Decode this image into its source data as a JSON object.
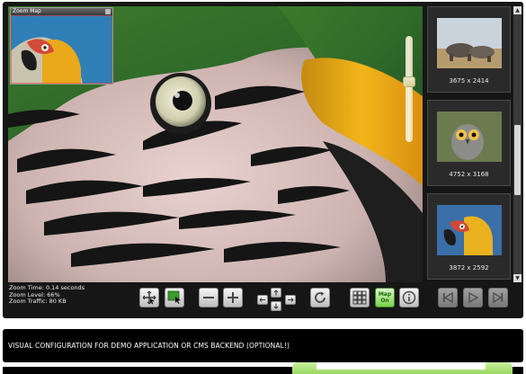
{
  "zoom_map": {
    "title": "Zoom Map"
  },
  "status": {
    "zoom_time": "Zoom Time: 0.14 seconds",
    "zoom_level": "Zoom Level: 66%",
    "zoom_traffic": "Zoom Traffic: 80 KB"
  },
  "zoom_slider": {
    "level": 0.42
  },
  "gallery": {
    "items": [
      {
        "icon": "rhino-thumbnail",
        "size": "3675 x 2414"
      },
      {
        "icon": "owl-thumbnail",
        "size": "4752 x 3168"
      },
      {
        "icon": "parrot-thumbnail",
        "size": "3872 x 2592"
      }
    ]
  },
  "toolbar": {
    "map_label_top": "Map",
    "map_label_bottom": "On",
    "icons": [
      "pan-icon",
      "select-zoom-icon",
      "zoom-out-icon",
      "zoom-in-icon",
      "pan-left-icon",
      "pan-up-icon",
      "pan-down-icon",
      "pan-right-icon",
      "reset-icon",
      "grid-icon",
      "map-toggle",
      "info-icon",
      "first-icon",
      "play-icon",
      "last-icon"
    ]
  },
  "config": {
    "label": "VISUAL CONFIGURATION FOR DEMO APPLICATION OR CMS BACKEND (OPTIONAL!)"
  }
}
